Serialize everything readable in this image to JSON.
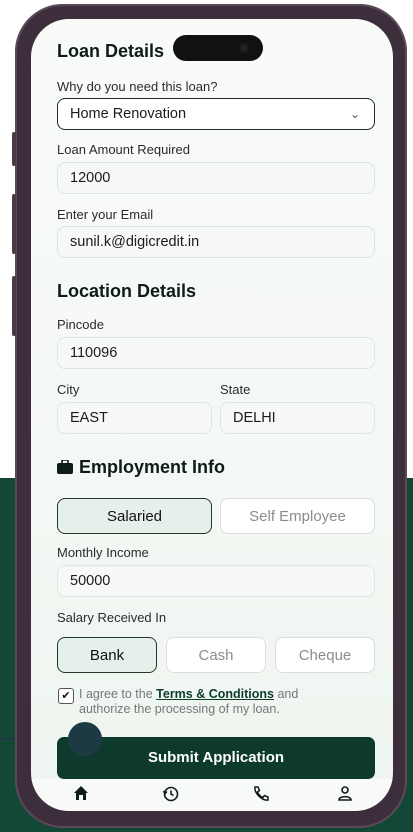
{
  "loan_details": {
    "title": "Loan Details",
    "purpose_label": "Why do you need this loan?",
    "purpose_value": "Home Renovation",
    "amount_label": "Loan Amount Required",
    "amount_value": "12000",
    "email_label": "Enter your Email",
    "email_value": "sunil.k@digicredit.in"
  },
  "location_details": {
    "title": "Location Details",
    "pincode_label": "Pincode",
    "pincode_value": "110096",
    "city_label": "City",
    "city_value": "EAST",
    "state_label": "State",
    "state_value": "DELHI"
  },
  "employment": {
    "title": "Employment Info",
    "options": [
      "Salaried",
      "Self Employee"
    ],
    "selected": "Salaried",
    "income_label": "Monthly Income",
    "income_value": "50000",
    "salary_label": "Salary Received In",
    "salary_options": [
      "Bank",
      "Cash",
      "Cheque"
    ],
    "salary_selected": "Bank"
  },
  "agreement": {
    "checked": true,
    "prefix": "I agree to the",
    "link": "Terms & Conditions",
    "suffix": "and",
    "line2": "authorize the processing of my loan."
  },
  "submit_label": "Submit Application",
  "tabbar_icons": [
    "home-icon",
    "history-icon",
    "phone-icon",
    "profile-icon"
  ],
  "colors": {
    "brand": "#0d3a2c",
    "background": "#134836"
  }
}
